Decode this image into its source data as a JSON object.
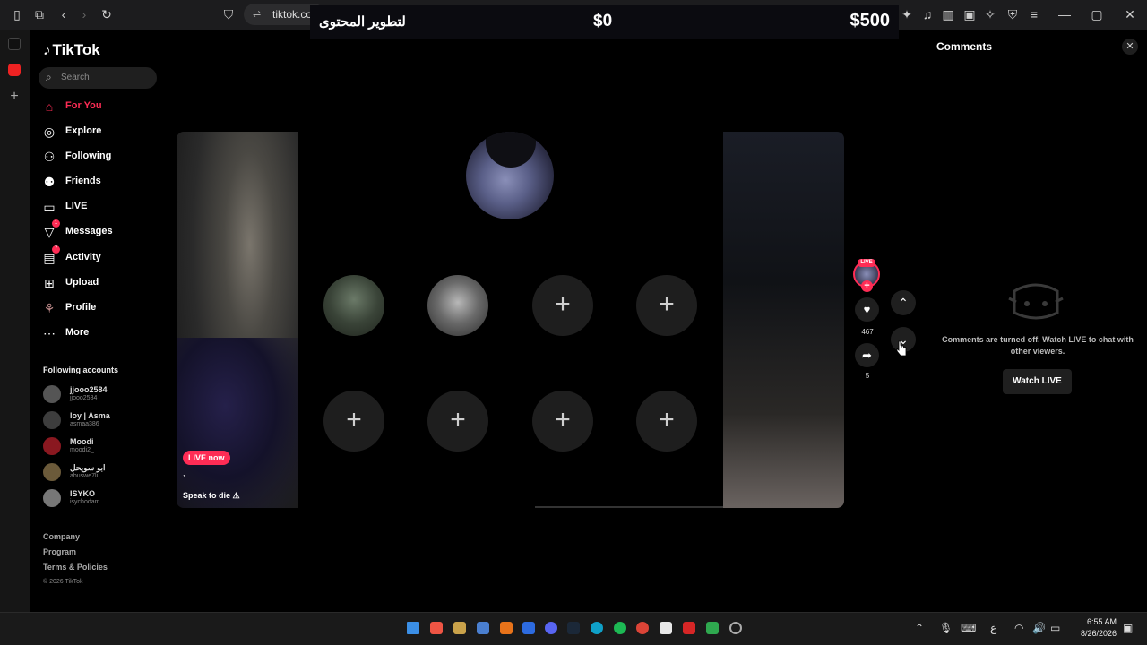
{
  "browser": {
    "url": "tiktok.co",
    "nav_icons": [
      "sidebar-toggle-icon",
      "tabs-icon",
      "back-icon",
      "forward-icon",
      "reload-icon",
      "bookmark-icon"
    ],
    "right_icons": [
      "extensions-icon",
      "media-icon",
      "sidebar-icon",
      "wallet-icon",
      "ai-icon",
      "shield-icon",
      "menu-icon"
    ],
    "window_controls": {
      "minimize": "—",
      "maximize": "▢",
      "close": "✕"
    }
  },
  "banner": {
    "arabic_text": "لتطوير المحتوى",
    "min_amount": "$0",
    "max_amount": "$500"
  },
  "tiktok": {
    "logo": "TikTok",
    "search_placeholder": "Search",
    "nav": [
      {
        "label": "For You",
        "icon": "home-icon",
        "active": true
      },
      {
        "label": "Explore",
        "icon": "compass-icon"
      },
      {
        "label": "Following",
        "icon": "following-icon"
      },
      {
        "label": "Friends",
        "icon": "friends-icon"
      },
      {
        "label": "LIVE",
        "icon": "live-icon"
      },
      {
        "label": "Messages",
        "icon": "messages-icon",
        "badge": "1"
      },
      {
        "label": "Activity",
        "icon": "activity-icon",
        "badge": "7"
      },
      {
        "label": "Upload",
        "icon": "upload-icon"
      },
      {
        "label": "Profile",
        "icon": "profile-icon"
      },
      {
        "label": "More",
        "icon": "more-icon"
      }
    ],
    "following_header": "Following accounts",
    "accounts": [
      {
        "name": "jjooo2584",
        "username": "jjooo2584"
      },
      {
        "name": "loy | Asma",
        "username": "asmaa386"
      },
      {
        "name": "Moodi",
        "username": "moodi2_"
      },
      {
        "name": "ابو سويحل",
        "username": "abuswe7li"
      },
      {
        "name": "ISYKO",
        "username": "isychodam"
      }
    ],
    "footer": {
      "company": "Company",
      "program": "Program",
      "terms": "Terms & Policies",
      "copyright": "© 2026 TikTok"
    }
  },
  "live": {
    "live_now": "LIVE now",
    "comma": ",",
    "title": "Speak to die ⚠",
    "slot_plus": "+",
    "live_tag": "LIVE",
    "likes": "467",
    "shares": "5"
  },
  "comments": {
    "title": "Comments",
    "off_message": "Comments are turned off. Watch LIVE to chat with other viewers.",
    "watch_button": "Watch LIVE"
  },
  "taskbar": {
    "time": "6:55 AM",
    "date": "8/26/2026",
    "lang": "ع"
  }
}
